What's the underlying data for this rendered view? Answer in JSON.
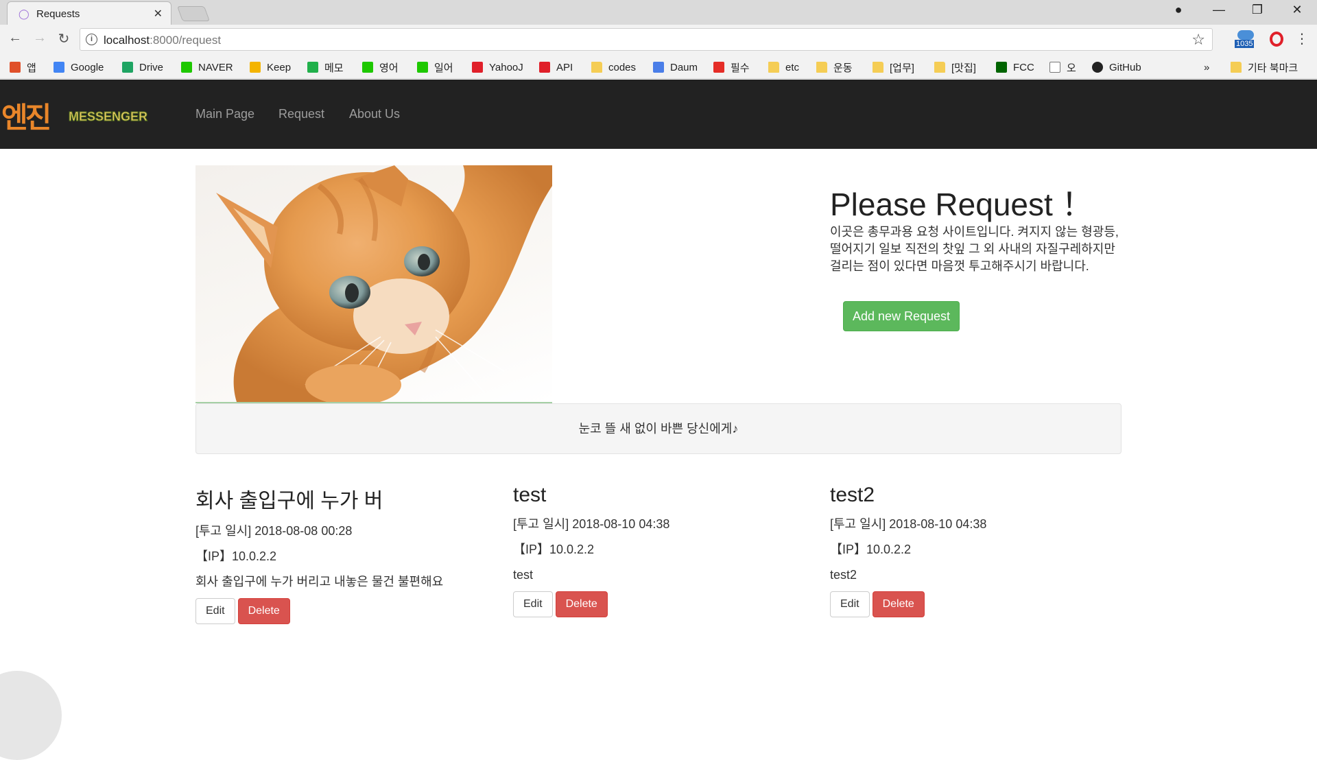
{
  "browser": {
    "tab_title": "Requests",
    "url_host": "localhost",
    "url_path": ":8000/request",
    "extension_badge": "1035",
    "bookmarks": [
      {
        "label": "앱",
        "icon": "apps-grid-icon",
        "color": "#e0502a"
      },
      {
        "label": "Google",
        "icon": "google-icon",
        "color": "#4285f4"
      },
      {
        "label": "Drive",
        "icon": "drive-icon",
        "color": "#1fa463"
      },
      {
        "label": "NAVER",
        "icon": "naver-icon",
        "color": "#1ec800"
      },
      {
        "label": "Keep",
        "icon": "keep-icon",
        "color": "#f4b400"
      },
      {
        "label": "메모",
        "icon": "memo-icon",
        "color": "#21b04b"
      },
      {
        "label": "영어",
        "icon": "dict-icon",
        "color": "#1ec800"
      },
      {
        "label": "일어",
        "icon": "dict-icon",
        "color": "#1ec800"
      },
      {
        "label": "YahooJ",
        "icon": "yahoo-icon",
        "color": "#e0202a"
      },
      {
        "label": "API",
        "icon": "api-icon",
        "color": "#e0202a"
      },
      {
        "label": "codes",
        "icon": "folder-icon",
        "color": "#f5cd55"
      },
      {
        "label": "Daum",
        "icon": "daum-icon",
        "color": "#4a7ee8"
      },
      {
        "label": "필수",
        "icon": "youtube-icon",
        "color": "#e52d27"
      },
      {
        "label": "etc",
        "icon": "folder-icon",
        "color": "#f5cd55"
      },
      {
        "label": "운동",
        "icon": "folder-icon",
        "color": "#f5cd55"
      },
      {
        "label": "[업무]",
        "icon": "folder-icon",
        "color": "#f5cd55"
      },
      {
        "label": "[맛집]",
        "icon": "folder-icon",
        "color": "#f5cd55"
      },
      {
        "label": "FCC",
        "icon": "fcc-icon",
        "color": "#006400"
      },
      {
        "label": "오",
        "icon": "page-icon",
        "color": "#ffffff"
      },
      {
        "label": "GitHub",
        "icon": "github-icon",
        "color": "#222222"
      }
    ],
    "more_label": "»",
    "other_bookmarks": "기타 북마크"
  },
  "navbar": {
    "brand_mark": "엔진",
    "brand_word": "MESSENGER",
    "links": [
      "Main Page",
      "Request",
      "About Us"
    ]
  },
  "hero": {
    "title": "Please Request ！",
    "text": "이곳은 총무과용 요청 사이트입니다. 켜지지 않는 형광등, 떨어지기 일보 직전의 찻잎 그 외 사내의 자질구레하지만 걸리는 점이 있다면 마음껏 투고해주시기 바랍니다.",
    "button": "Add new Request"
  },
  "well_text": "눈코 뜰 새 없이 바쁜 당신에게♪",
  "requests": [
    {
      "title": "회사 출입구에 누가 버",
      "posted": "[투고 일시] 2018-08-08 00:28",
      "ip": "【IP】10.0.2.2",
      "body": "회사 출입구에 누가 버리고 내놓은 물건 불편해요",
      "edit": "Edit",
      "delete": "Delete"
    },
    {
      "title": "test",
      "posted": "[투고 일시] 2018-08-10 04:38",
      "ip": "【IP】10.0.2.2",
      "body": "test",
      "edit": "Edit",
      "delete": "Delete"
    },
    {
      "title": "test2",
      "posted": "[투고 일시] 2018-08-10 04:38",
      "ip": "【IP】10.0.2.2",
      "body": "test2",
      "edit": "Edit",
      "delete": "Delete"
    }
  ]
}
